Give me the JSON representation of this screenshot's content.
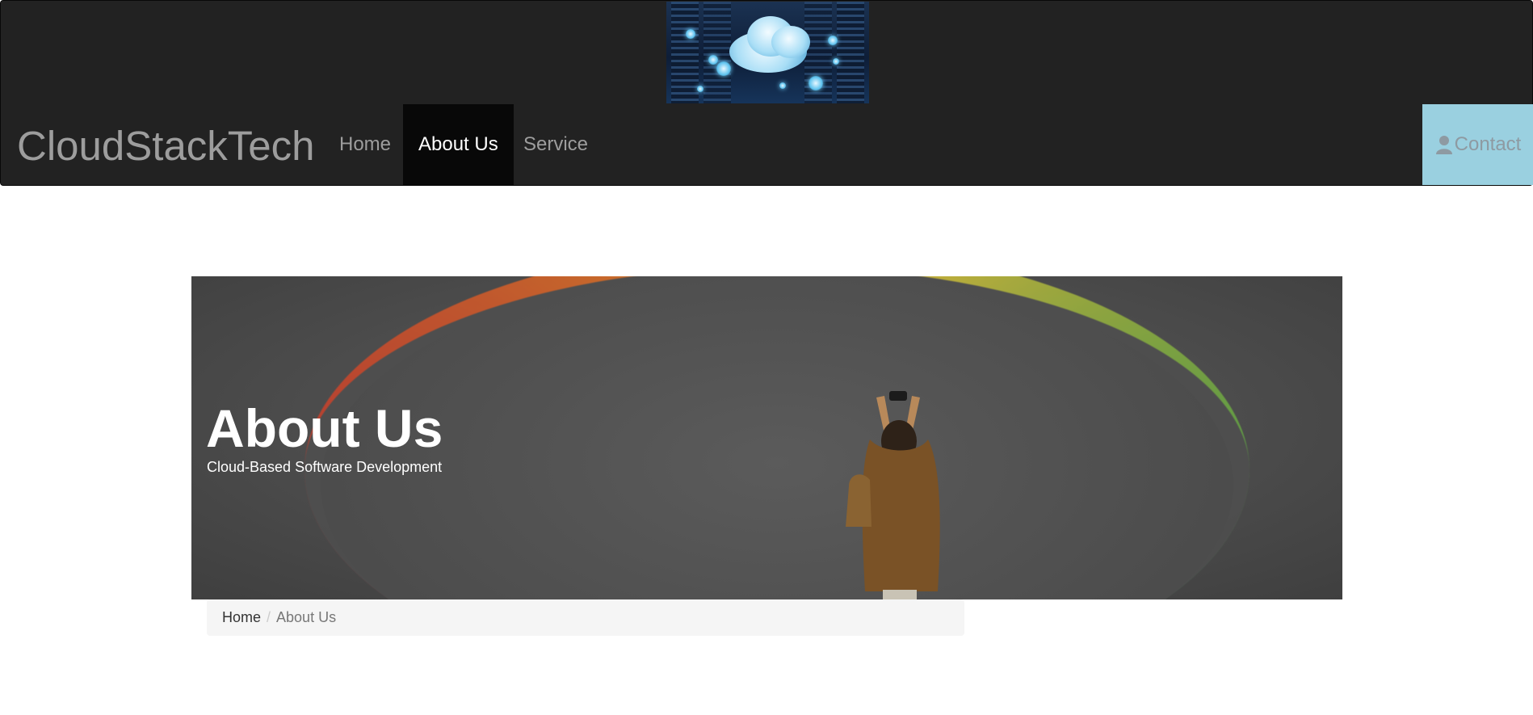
{
  "navbar": {
    "brand": "CloudStackTech",
    "items": [
      {
        "label": "Home"
      },
      {
        "label": "About Us",
        "active": true
      },
      {
        "label": "Service"
      }
    ],
    "contact_label": "Contact",
    "contact_icon": "user-icon",
    "banner_icon": "cloud-server-icon"
  },
  "hero": {
    "title": "About Us",
    "subtitle": "Cloud-Based Software Development"
  },
  "breadcrumb": {
    "home": "Home",
    "separator": "/",
    "current": "About Us"
  },
  "colors": {
    "navbar_bg": "#222222",
    "nav_active_bg": "#080808",
    "contact_bg": "#9ad0e0",
    "breadcrumb_bg": "#f5f5f5"
  }
}
